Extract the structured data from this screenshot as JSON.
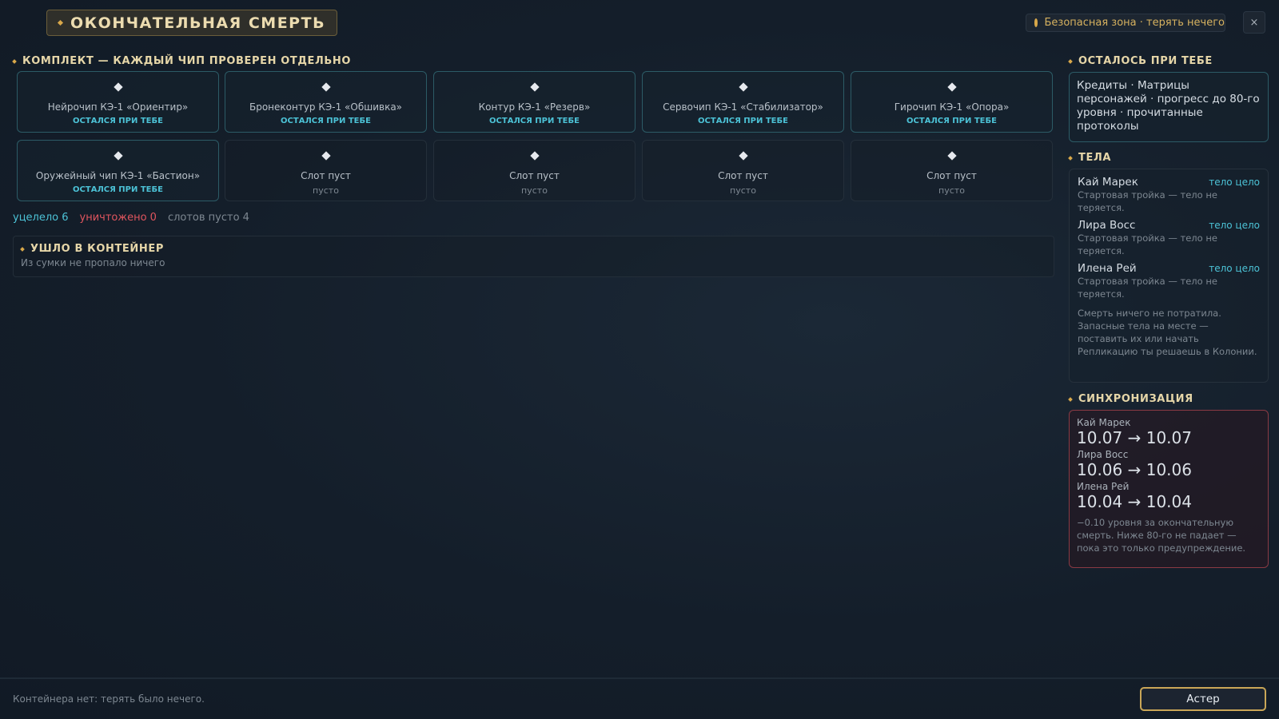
{
  "header": {
    "title": "ОКОНЧАТЕЛЬНАЯ СМЕРТЬ",
    "zone_text": "Безопасная зона · терять нечего",
    "close_label": "×"
  },
  "colors": {
    "accent_gold": "#d9a84a",
    "kept_cyan": "#4cc2d6",
    "destroyed_red": "#e0555e",
    "sync_border": "#8a3a44"
  },
  "kit": {
    "heading": "КОМПЛЕКТ — КАЖДЫЙ ЧИП ПРОВЕРЕН ОТДЕЛЬНО",
    "slots": [
      {
        "name": "Нейрочип КЭ-1 «Ориентир»",
        "status": "ОСТАЛСЯ ПРИ ТЕБЕ"
      },
      {
        "name": "Бронеконтур КЭ-1 «Обшивка»",
        "status": "ОСТАЛСЯ ПРИ ТЕБЕ"
      },
      {
        "name": "Контур КЭ-1 «Резерв»",
        "status": "ОСТАЛСЯ ПРИ ТЕБЕ"
      },
      {
        "name": "Сервочип КЭ-1 «Стабилизатор»",
        "status": "ОСТАЛСЯ ПРИ ТЕБЕ"
      },
      {
        "name": "Гирочип КЭ-1 «Опора»",
        "status": "ОСТАЛСЯ ПРИ ТЕБЕ"
      },
      {
        "name": "Оружейный чип КЭ-1 «Бастион»",
        "status": "ОСТАЛСЯ ПРИ ТЕБЕ"
      },
      {
        "name": "Слот пуст",
        "status": "пусто"
      },
      {
        "name": "Слот пуст",
        "status": "пусто"
      },
      {
        "name": "Слот пуст",
        "status": "пусто"
      },
      {
        "name": "Слот пуст",
        "status": "пусто"
      }
    ],
    "summary": {
      "kept": "уцелело 6",
      "destroyed": "уничтожено 0",
      "empty": "слотов пусто 4"
    }
  },
  "container": {
    "heading": "УШЛО В КОНТЕЙНЕР",
    "text": "Из сумки не пропало ничего"
  },
  "kept_panel": {
    "heading": "ОСТАЛОСЬ ПРИ ТЕБЕ",
    "text": "Кредиты · Матрицы персонажей · прогресс до 80-го уровня · прочитанные протоколы"
  },
  "bodies": {
    "heading": "ТЕЛА",
    "items": [
      {
        "name": "Кай Марек",
        "tag": "тело цело",
        "desc": "Стартовая тройка — тело не теряется."
      },
      {
        "name": "Лира Восс",
        "tag": "тело цело",
        "desc": "Стартовая тройка — тело не теряется."
      },
      {
        "name": "Илена Рей",
        "tag": "тело цело",
        "desc": "Стартовая тройка — тело не теряется."
      }
    ],
    "note": "Смерть ничего не потратила. Запасные тела на месте — поставить их или начать Репликацию ты решаешь в Колонии."
  },
  "sync": {
    "heading": "СИНХРОНИЗАЦИЯ",
    "items": [
      {
        "name": "Кай Марек",
        "value": "10.07 → 10.07"
      },
      {
        "name": "Лира Восс",
        "value": "10.06 → 10.06"
      },
      {
        "name": "Илена Рей",
        "value": "10.04 → 10.04"
      }
    ],
    "note": "−0.10 уровня за окончательную смерть. Ниже 80-го не падает — пока это только предупреждение."
  },
  "footer": {
    "text": "Контейнера нет: терять было нечего.",
    "button_label": "Астер"
  }
}
